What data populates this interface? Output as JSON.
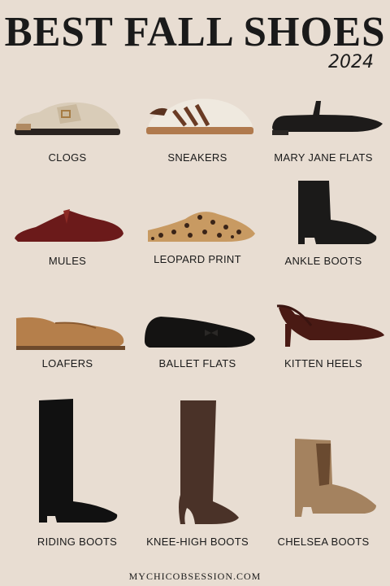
{
  "header": {
    "title": "BEST FALL SHOES",
    "year": "2024"
  },
  "items": [
    {
      "label": "CLOGS"
    },
    {
      "label": "SNEAKERS"
    },
    {
      "label": "MARY JANE FLATS"
    },
    {
      "label": "MULES"
    },
    {
      "label": "LEOPARD PRINT"
    },
    {
      "label": "ANKLE BOOTS"
    },
    {
      "label": "LOAFERS"
    },
    {
      "label": "BALLET FLATS"
    },
    {
      "label": "KITTEN HEELS"
    },
    {
      "label": "RIDING BOOTS"
    },
    {
      "label": "KNEE-HIGH BOOTS"
    },
    {
      "label": "CHELSEA BOOTS"
    }
  ],
  "footer": {
    "text": "MYCHICOBSESSION.COM"
  },
  "colors": {
    "background": "#e8ddd2",
    "text": "#1a1a1a"
  }
}
